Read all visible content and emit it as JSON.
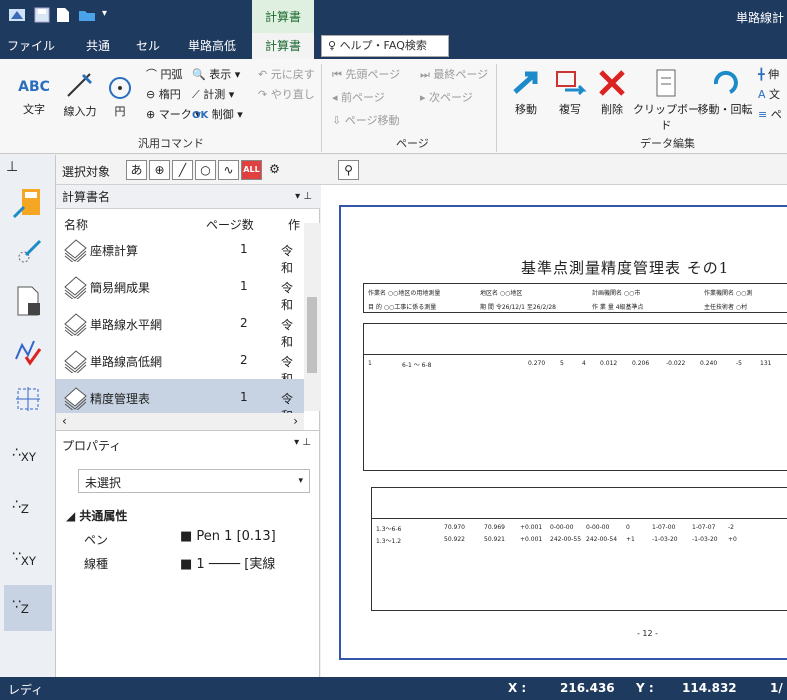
{
  "window": {
    "title": "単路線計",
    "context_tab": "計算書"
  },
  "menu": {
    "tabs": [
      "ファイル",
      "共通",
      "セル",
      "単路高低",
      "計算書"
    ],
    "help_search": "ヘルプ・FAQ検索"
  },
  "ribbon": {
    "groups": [
      "汎用コマンド",
      "ページ",
      "データ編集"
    ],
    "general": {
      "text": "文字",
      "line_input": "線入力",
      "circle": "円",
      "arc": "円弧",
      "ellipse": "楕円",
      "mark": "マーク",
      "display": "表示",
      "measure": "計測",
      "control": "制御",
      "undo": "元に戻す",
      "redo": "やり直し"
    },
    "page": {
      "first": "先頭ページ",
      "last": "最終ページ",
      "prev": "前ページ",
      "next": "次ページ",
      "move": "ページ移動"
    },
    "edit": {
      "move": "移動",
      "copy": "複写",
      "delete": "削除",
      "clipboard": "クリップボード",
      "move_rotate": "移動・回転",
      "extra1": "伸",
      "extra2": "文",
      "extra3": "ペ"
    }
  },
  "toolbar": {
    "select_label": "選択対象",
    "glyph_text": "あ",
    "glyph_all": "ALL"
  },
  "calc_panel": {
    "title": "計算書名",
    "columns": {
      "name": "名称",
      "pages": "ページ数",
      "author": "作"
    },
    "rows": [
      {
        "name": "座標計算",
        "pages": "1",
        "author": "令和"
      },
      {
        "name": "簡易網成果",
        "pages": "1",
        "author": "令和"
      },
      {
        "name": "単路線水平網",
        "pages": "2",
        "author": "令和"
      },
      {
        "name": "単路線高低網",
        "pages": "2",
        "author": "令和"
      },
      {
        "name": "精度管理表",
        "pages": "1",
        "author": "令和"
      }
    ]
  },
  "prop_panel": {
    "title": "プロパティ",
    "selection": "未選択",
    "section": "共通属性",
    "rows": [
      {
        "label": "ペン",
        "value": "Pen 1 [0.13]"
      },
      {
        "label": "線種",
        "value": "1 ──── [実線"
      }
    ]
  },
  "document": {
    "title": "基準点測量精度管理表 その1",
    "meta": [
      "作業名 ○○地区の用地測量",
      "地区名 ○○地区",
      "計画機関名 ○○市",
      "作業機関名 ○○測",
      "目 的 ○○工事に係る測量",
      "期 間 令26/12/1 至26/2/28",
      "作 業 量 4級基準点",
      "主任技術者 ○村"
    ],
    "row1": {
      "route": "1",
      "points": "6-1 ～ 6-8",
      "length": "0.270",
      "angles": "5",
      "sides": "4",
      "v1": "0.012",
      "v2": "0.206",
      "v3": "-0.022",
      "v4": "0.240",
      "v5": "-5",
      "v6": "131"
    },
    "table2_rows": [
      {
        "pts": "1.3～6-6",
        "a": "70.970",
        "b": "70.969",
        "c": "+0.001",
        "d": "0-00-00",
        "e": "0-00-00",
        "f": "0",
        "g": "1-07-00",
        "h": "1-07-07",
        "i": "-2"
      },
      {
        "pts": "1.3～1.2",
        "a": "50.922",
        "b": "50.921",
        "c": "+0.001",
        "d": "242-00-55",
        "e": "242-00-54",
        "f": "+1",
        "g": "-1-03-20",
        "h": "-1-03-20",
        "i": "+0"
      }
    ],
    "footer": "- 12 -"
  },
  "status": {
    "mode": "レディ",
    "x_label": "X :",
    "x": "216.436",
    "y_label": "Y :",
    "y": "114.832",
    "page": "1/"
  }
}
